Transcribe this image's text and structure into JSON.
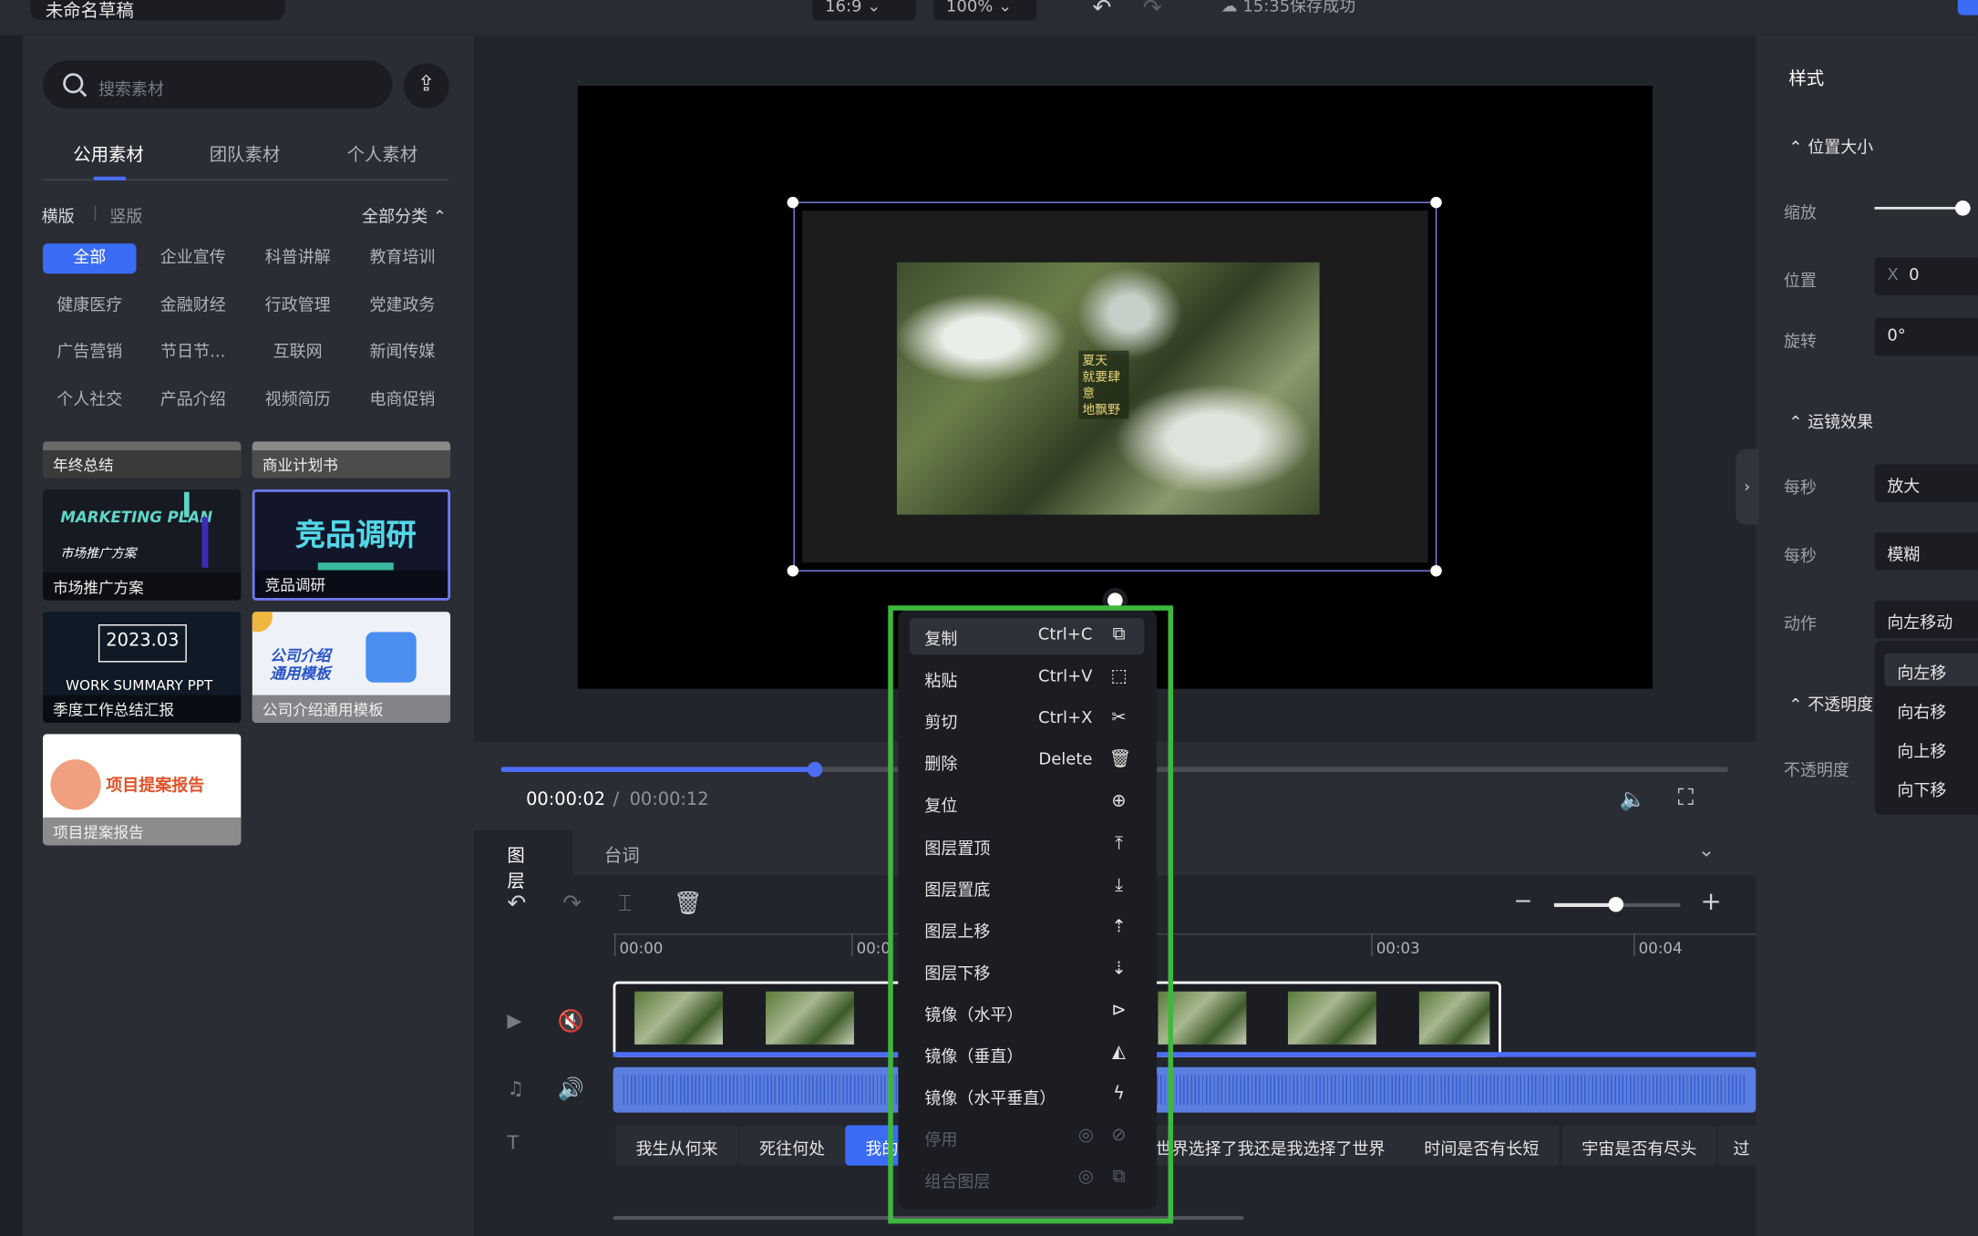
{
  "topbar": {
    "project_name": "未命名草稿",
    "aspect_ratio": "16:9",
    "zoom": "100%",
    "save_status": "15:35保存成功",
    "undo_icon": "undo-icon",
    "redo_icon": "redo-icon",
    "cloud_icon": "cloud-sync-icon"
  },
  "assets": {
    "search_placeholder": "搜索素材",
    "tabs": [
      "公用素材",
      "团队素材",
      "个人素材"
    ],
    "orientation": [
      "横版",
      "竖版"
    ],
    "all_categories": "全部分类",
    "categories": [
      [
        "全部",
        "企业宣传",
        "科普讲解",
        "教育培训"
      ],
      [
        "健康医疗",
        "金融财经",
        "行政管理",
        "党建政务"
      ],
      [
        "广告营销",
        "节日节...",
        "互联网",
        "新闻传媒"
      ],
      [
        "个人社交",
        "产品介绍",
        "视频简历",
        "电商促销"
      ]
    ],
    "templates": [
      {
        "label": "年终总结"
      },
      {
        "label": "商业计划书"
      },
      {
        "label": "市场推广方案",
        "art_title": "MARKETING PLAN",
        "art_sub": "市场推广方案"
      },
      {
        "label": "竞品调研",
        "art_title": "竞品调研"
      },
      {
        "label": "季度工作总结汇报",
        "art_title": "2023.03",
        "art_sub": "WORK SUMMARY PPT"
      },
      {
        "label": "公司介绍通用模板",
        "art_title": "公司介绍",
        "art_sub": "通用模板"
      },
      {
        "label": "项目提案报告",
        "art_title": "项目提案报告"
      }
    ]
  },
  "preview": {
    "overlay_text": [
      "夏天",
      "就要肆意",
      "地飘野"
    ],
    "current_time": "00:00:02",
    "separator": "/",
    "total_time": "00:00:12",
    "progress": 0.256
  },
  "timeline": {
    "tabs": [
      "图层",
      "台词"
    ],
    "ruler": [
      "00:00",
      "00:0",
      "00:03",
      "00:04"
    ],
    "subtitles": [
      "我生从何来",
      "死往何处",
      "我的",
      "世界选择了我还是我选择了世界",
      "时间是否有长短",
      "宇宙是否有尽头",
      "过"
    ]
  },
  "context_menu": {
    "items": [
      {
        "label": "复制",
        "shortcut": "Ctrl+C",
        "icon": "⧉"
      },
      {
        "label": "粘贴",
        "shortcut": "Ctrl+V",
        "icon": "⬚"
      },
      {
        "label": "剪切",
        "shortcut": "Ctrl+X",
        "icon": "✂"
      },
      {
        "label": "删除",
        "shortcut": "Delete",
        "icon": "🗑"
      },
      {
        "label": "复位",
        "shortcut": "",
        "icon": "⊕"
      },
      {
        "label": "图层置顶",
        "shortcut": "",
        "icon": "⤒"
      },
      {
        "label": "图层置底",
        "shortcut": "",
        "icon": "⤓"
      },
      {
        "label": "图层上移",
        "shortcut": "",
        "icon": "⇡"
      },
      {
        "label": "图层下移",
        "shortcut": "",
        "icon": "⇣"
      },
      {
        "label": "镜像（水平）",
        "shortcut": "",
        "icon": "⊳"
      },
      {
        "label": "镜像（垂直）",
        "shortcut": "",
        "icon": "◭"
      },
      {
        "label": "镜像（水平垂直）",
        "shortcut": "",
        "icon": "ϟ"
      },
      {
        "label": "停用",
        "shortcut": "",
        "icon": "⊘"
      },
      {
        "label": "组合图层",
        "shortcut": "",
        "icon": "⧉"
      }
    ]
  },
  "properties": {
    "title": "样式",
    "section_position": "位置大小",
    "scale_label": "缩放",
    "position_label": "位置",
    "x_label": "X",
    "x_value": "0",
    "rotate_label": "旋转",
    "rotate_value": "0°",
    "section_motion": "运镜效果",
    "per_second_1": "每秒",
    "per_second_1_value": "放大",
    "per_second_2": "每秒",
    "per_second_2_value": "模糊",
    "action_label": "动作",
    "action_value": "向左移动",
    "section_opacity": "不透明度",
    "opacity_label": "不透明度",
    "action_options": [
      "向左移",
      "向右移",
      "向上移",
      "向下移"
    ]
  }
}
